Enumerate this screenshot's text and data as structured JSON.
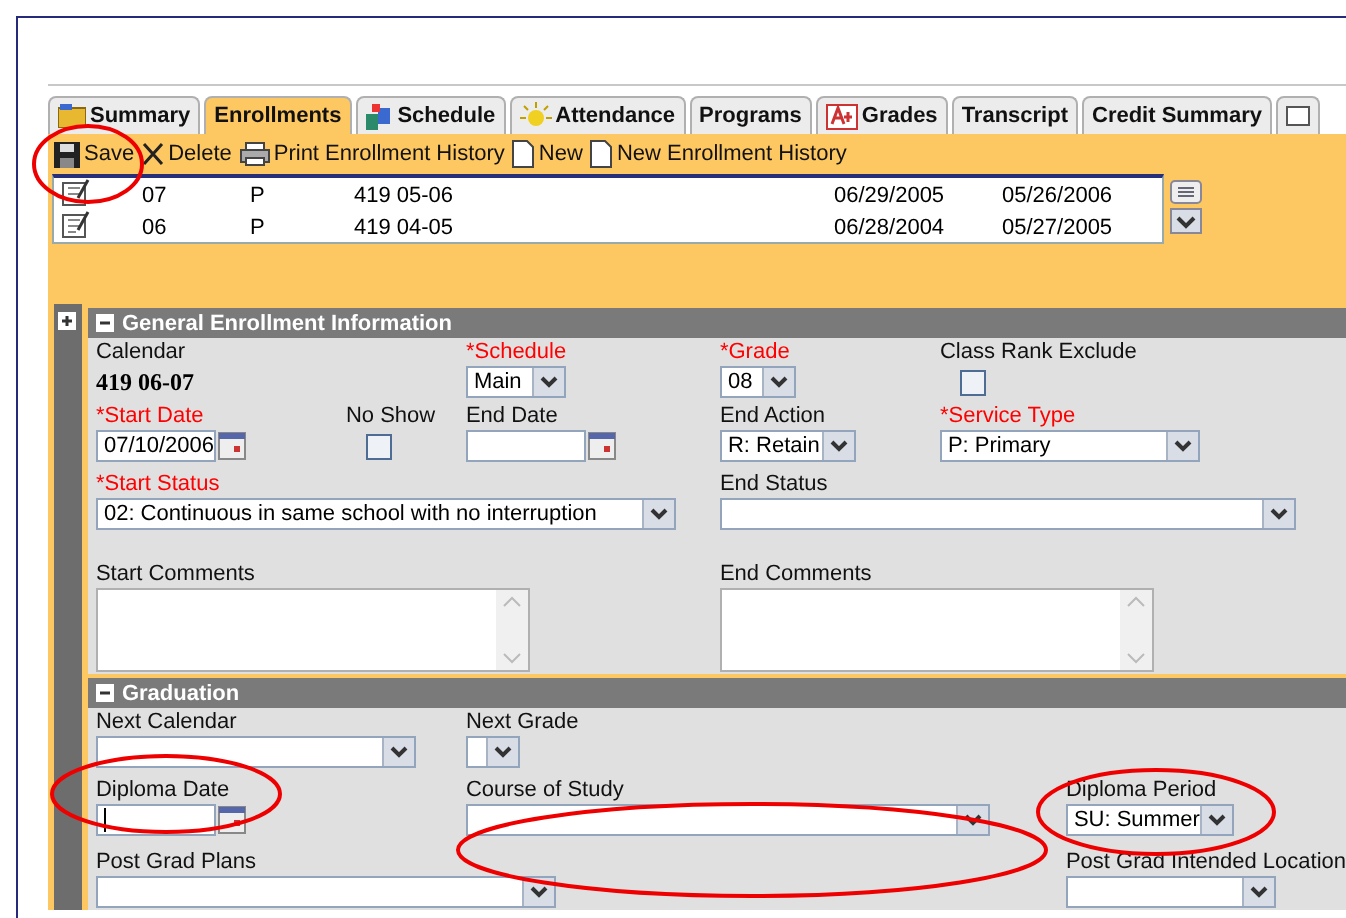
{
  "tabs": [
    {
      "label": "Summary",
      "selected": false
    },
    {
      "label": "Enrollments",
      "selected": true
    },
    {
      "label": "Schedule",
      "selected": false
    },
    {
      "label": "Attendance",
      "selected": false
    },
    {
      "label": "Programs",
      "selected": false
    },
    {
      "label": "Grades",
      "selected": false
    },
    {
      "label": "Transcript",
      "selected": false
    },
    {
      "label": "Credit Summary",
      "selected": false
    }
  ],
  "toolbar": [
    {
      "label": "Save"
    },
    {
      "label": "Delete"
    },
    {
      "label": "Print Enrollment History"
    },
    {
      "label": "New"
    },
    {
      "label": "New Enrollment History"
    }
  ],
  "enrollment_list": [
    {
      "column_1": "07",
      "column_2": "P",
      "column_3": "419 05-06",
      "column_4": "06/29/2005",
      "column_5": "05/26/2006"
    },
    {
      "column_1": "06",
      "column_2": "P",
      "column_3": "419 04-05",
      "column_4": "06/28/2004",
      "column_5": "05/27/2005"
    }
  ],
  "sections": [
    {
      "title": "General Enrollment Information",
      "expanded": true,
      "fields": [
        {
          "kind": "readonly",
          "label": "Calendar",
          "required": false,
          "value": "419 06-07"
        },
        {
          "kind": "select",
          "label": "*Schedule",
          "required": true,
          "value": "Main"
        },
        {
          "kind": "select",
          "label": "*Grade",
          "required": true,
          "value": "08"
        },
        {
          "kind": "checkbox",
          "label": "Class Rank Exclude",
          "required": false,
          "checked": false
        },
        {
          "kind": "date",
          "label": "*Start Date",
          "required": true,
          "value": "07/10/2006"
        },
        {
          "kind": "checkbox",
          "label": "No Show",
          "required": false,
          "checked": false
        },
        {
          "kind": "date",
          "label": "End Date",
          "required": false
        },
        {
          "kind": "select",
          "label": "End Action",
          "required": false,
          "value": "R: Retain"
        },
        {
          "kind": "select",
          "label": "*Service Type",
          "required": true,
          "value": "P: Primary"
        },
        {
          "kind": "select",
          "label": "*Start Status",
          "required": true,
          "value": "02: Continuous in same school with no interruption"
        },
        {
          "kind": "select",
          "label": "End Status",
          "required": false
        },
        {
          "kind": "textarea",
          "label": "Start Comments",
          "required": false
        },
        {
          "kind": "textarea",
          "label": "End Comments",
          "required": false
        }
      ]
    },
    {
      "title": "Graduation",
      "expanded": true,
      "fields": [
        {
          "kind": "select",
          "label": "Next Calendar",
          "required": false
        },
        {
          "kind": "select",
          "label": "Next Grade",
          "required": false
        },
        {
          "kind": "date",
          "label": "Diploma Date",
          "required": false,
          "focused": true
        },
        {
          "kind": "select",
          "label": "Course of Study",
          "required": false
        },
        {
          "kind": "select",
          "label": "Diploma Period",
          "required": false,
          "value": "SU: Summer"
        },
        {
          "kind": "select",
          "label": "Post Grad Plans",
          "required": false
        },
        {
          "kind": "select",
          "label": "Post Grad Intended Location",
          "required": false
        }
      ]
    }
  ]
}
